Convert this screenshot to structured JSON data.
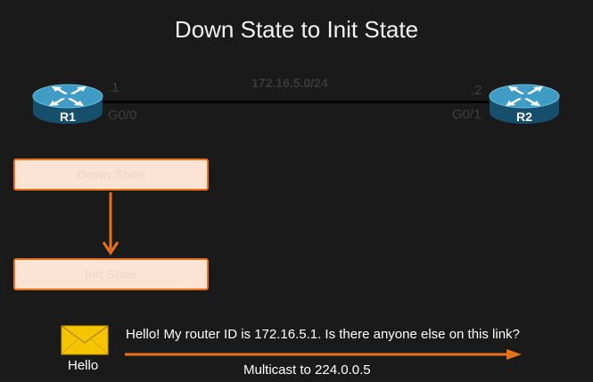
{
  "title": "Down State to Init State",
  "network": {
    "subnet": "172.16.5.0/24",
    "r1": {
      "name": "R1",
      "ip_suffix": ".1",
      "interface": "G0/0"
    },
    "r2": {
      "name": "R2",
      "ip_suffix": ".2",
      "interface": "G0/1"
    }
  },
  "states": {
    "first": "Down State",
    "second": "Init State"
  },
  "hello": {
    "label": "Hello",
    "message": "Hello! My router ID is 172.16.5.1. Is there anyone else on this link?",
    "multicast": "Multicast to 224.0.0.5"
  },
  "colors": {
    "background": "#1a1a1a",
    "accent": "#e8711a",
    "state_fill": "#fce3d3",
    "router_blue": "#1e6f92",
    "envelope": "#f6c400"
  },
  "icons": {
    "router": "router-icon",
    "envelope": "envelope-icon"
  }
}
